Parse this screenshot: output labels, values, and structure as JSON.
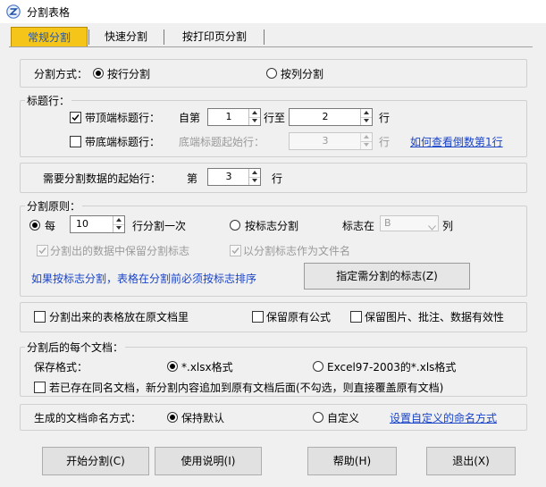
{
  "window": {
    "title": "分割表格",
    "icon": "app-logo-icon"
  },
  "tabs": [
    {
      "label": "常规分割",
      "active": true
    },
    {
      "label": "快速分割",
      "active": false
    },
    {
      "label": "按打印页分割",
      "active": false
    }
  ],
  "split_mode": {
    "label": "分割方式：",
    "by_row": "按行分割",
    "by_col": "按列分割",
    "selected": "by_row"
  },
  "header_rows": {
    "title": "标题行：",
    "top": {
      "label": "带顶端标题行：",
      "checked": true,
      "from_label": "自第",
      "from_value": "1",
      "to_label": "行至",
      "to_value": "2",
      "row_unit": "行"
    },
    "bottom": {
      "label": "带底端标题行：",
      "checked": false,
      "start_label": "底端标题起始行：",
      "start_value": "3",
      "row_unit": "行",
      "help_link": "如何查看倒数第1行"
    }
  },
  "start_row": {
    "label": "需要分割数据的起始行：",
    "prefix": "第",
    "value": "3",
    "unit": "行"
  },
  "principle": {
    "title": "分割原则：",
    "every": {
      "label": "每",
      "value": "10",
      "suffix": "行分割一次",
      "selected": true
    },
    "by_flag": {
      "label": "按标志分割",
      "selected": false,
      "flag_in_label": "标志在",
      "flag_col_value": "B",
      "col_unit": "列"
    },
    "keep_flag": {
      "label": "分割出的数据中保留分割标志",
      "checked": true,
      "disabled": true
    },
    "flag_as_name": {
      "label": "以分割标志作为文件名",
      "checked": true,
      "disabled": true
    },
    "sort_note": "如果按标志分割，表格在分割前必须按标志排序",
    "specify_button": "指定需分割的标志(Z)"
  },
  "options": {
    "place_in_original": {
      "label": "分割出来的表格放在原文档里",
      "checked": false
    },
    "keep_formula": {
      "label": "保留原有公式",
      "checked": false
    },
    "keep_media": {
      "label": "保留图片、批注、数据有效性",
      "checked": false
    }
  },
  "each_doc": {
    "title": "分割后的每个文档：",
    "format_label": "保存格式：",
    "xlsx": {
      "label": "*.xlsx格式",
      "selected": true
    },
    "xls": {
      "label": "Excel97-2003的*.xls格式",
      "selected": false
    },
    "append": {
      "label": "若已存在同名文档，新分割内容追加到原有文档后面(不勾选，则直接覆盖原有文档)",
      "checked": false
    }
  },
  "naming": {
    "label": "生成的文档命名方式：",
    "default": {
      "label": "保持默认",
      "selected": true
    },
    "custom": {
      "label": "自定义",
      "selected": false
    },
    "link": "设置自定义的命名方式"
  },
  "buttons": {
    "start": "开始分割(C)",
    "manual": "使用说明(I)",
    "help": "帮助(H)",
    "exit": "退出(X)"
  }
}
